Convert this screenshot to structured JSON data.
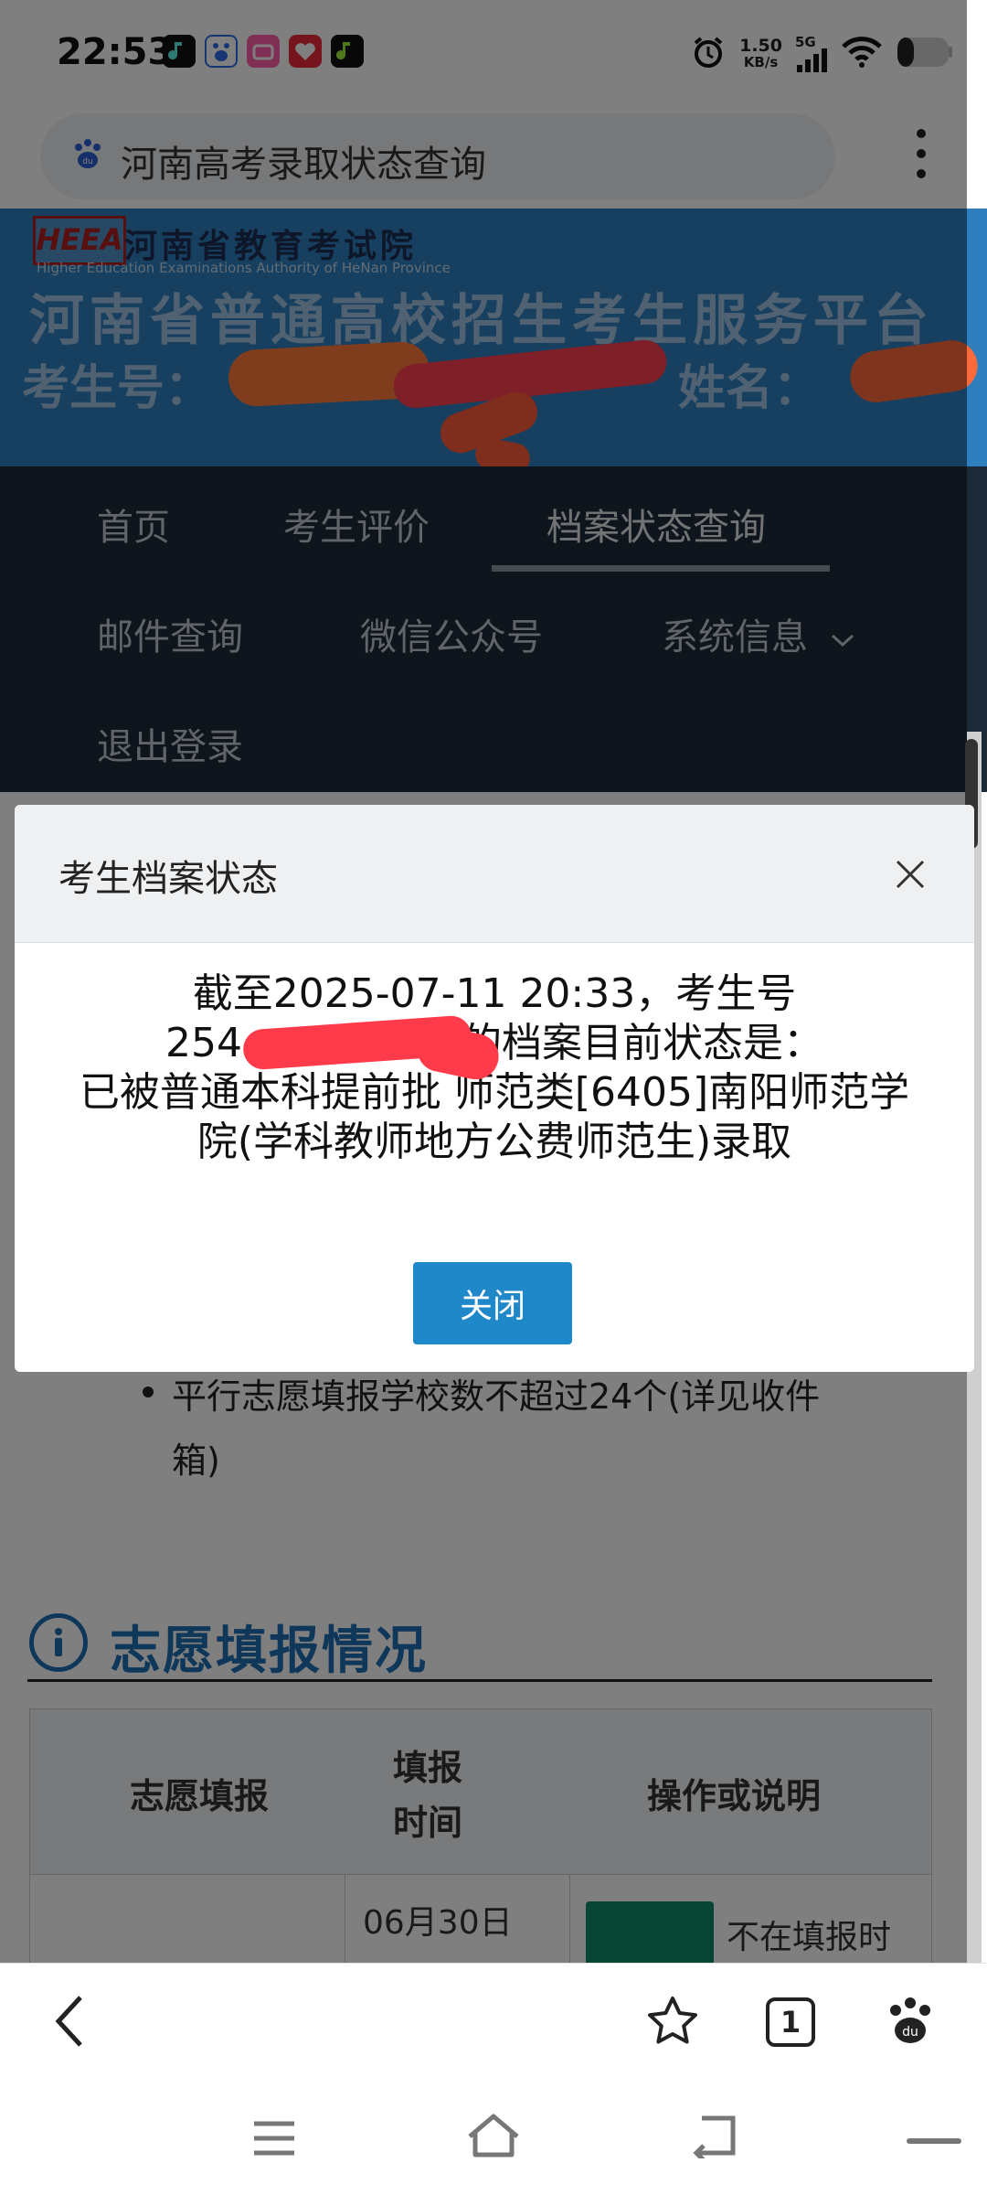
{
  "status_bar": {
    "time": "22:53",
    "speed_value": "1.50",
    "speed_unit": "KB/s",
    "network": "5G",
    "icons": [
      "music-app-icon",
      "baidu-app-icon",
      "video-app-icon",
      "heart-app-icon",
      "music-app-icon",
      "alarm-icon",
      "signal-icon",
      "wifi-icon",
      "battery-icon"
    ]
  },
  "browser": {
    "url_text": "河南高考录取状态查询",
    "tab_count": "1"
  },
  "site_header": {
    "logo_text": "HEEA",
    "org_name": "河南省教育考试院",
    "org_name_en": "Higher Education Examinations Authority of HeNan Province",
    "platform_title": "河南省普通高校招生考生服务平台",
    "exam_no_label": "考生号：",
    "name_label": "姓名："
  },
  "nav": {
    "items": [
      "首页",
      "考生评价",
      "档案状态查询",
      "邮件查询",
      "微信公众号",
      "系统信息",
      "退出登录"
    ],
    "active": "档案状态查询"
  },
  "page": {
    "bullet": "平行志愿填报学校数不超过24个(详见收件箱)",
    "section_title": "志愿填报情况",
    "table_headers": [
      "志愿填报",
      "填报时间",
      "操作或说明"
    ],
    "row_date": "06月30日",
    "row_note": "不在填报时"
  },
  "modal": {
    "title": "考生档案状态",
    "line1": "截至2025-07-11 20:33，考生号",
    "line2_prefix": "254",
    "line2_suffix": "的档案目前状态是：",
    "line3": "已被普通本科提前批 师范类[6405]南阳师范学",
    "line4": "院(学科教师地方公费师范生)录取",
    "close_button": "关闭"
  },
  "colors": {
    "header_blue": "#2f7fbe",
    "nav_dark": "#1c2a38",
    "primary_button": "#1f88c8",
    "section_blue": "#1f6fb4",
    "scribble_orange": "#ff6e3c",
    "scribble_red": "#ff3a4a"
  }
}
